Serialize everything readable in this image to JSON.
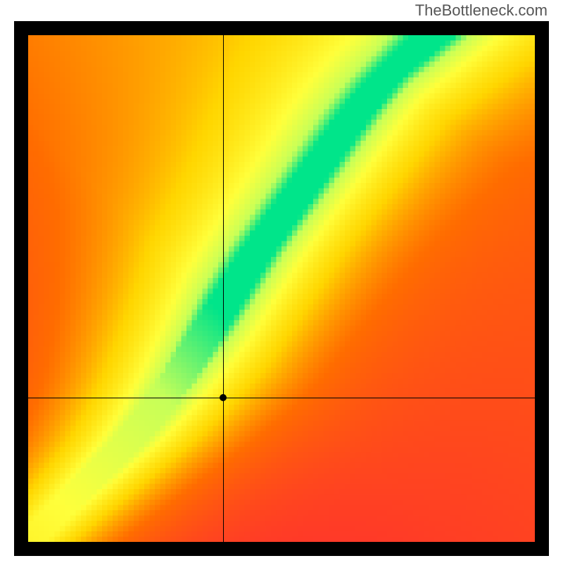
{
  "watermark": "TheBottleneck.com",
  "chart_data": {
    "type": "heatmap",
    "title": "",
    "xlabel": "",
    "ylabel": "",
    "xlim": [
      0,
      1
    ],
    "ylim": [
      0,
      1
    ],
    "grid_size": 96,
    "crosshair": {
      "x": 0.385,
      "y": 0.285
    },
    "optimal_curve": {
      "description": "Green optimal band: starts straight from origin to ~(0.30,0.30), then steepens upward toward ~(0.80,1.0)",
      "points": [
        [
          0.0,
          0.0
        ],
        [
          0.05,
          0.05
        ],
        [
          0.1,
          0.1
        ],
        [
          0.15,
          0.15
        ],
        [
          0.2,
          0.2
        ],
        [
          0.25,
          0.26
        ],
        [
          0.3,
          0.33
        ],
        [
          0.35,
          0.41
        ],
        [
          0.4,
          0.49
        ],
        [
          0.45,
          0.57
        ],
        [
          0.5,
          0.64
        ],
        [
          0.55,
          0.71
        ],
        [
          0.6,
          0.78
        ],
        [
          0.65,
          0.85
        ],
        [
          0.7,
          0.91
        ],
        [
          0.75,
          0.96
        ],
        [
          0.8,
          1.0
        ]
      ],
      "band_half_width": 0.035
    },
    "color_stops": [
      {
        "t": 0.0,
        "color": "#ff1744"
      },
      {
        "t": 0.35,
        "color": "#ff6d00"
      },
      {
        "t": 0.55,
        "color": "#ffd600"
      },
      {
        "t": 0.75,
        "color": "#ffff3b"
      },
      {
        "t": 0.9,
        "color": "#c6ff59"
      },
      {
        "t": 1.0,
        "color": "#00e58a"
      }
    ],
    "background_gradient": {
      "top_left": "#ff1744",
      "top_right": "#ffee00",
      "bottom_left": "#ff1744",
      "bottom_right": "#ff1744"
    }
  }
}
